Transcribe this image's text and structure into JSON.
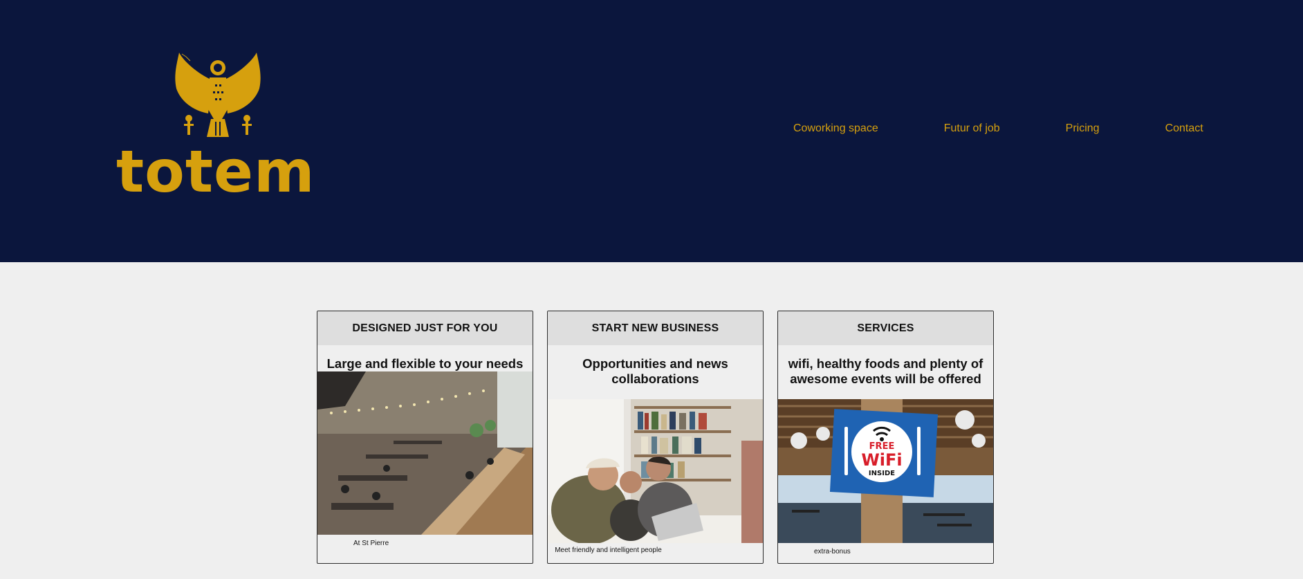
{
  "brand": {
    "name": "totem",
    "color": "#d6a00e",
    "header_bg": "#0b163d"
  },
  "nav": [
    {
      "label": "Coworking space"
    },
    {
      "label": "Futur of job"
    },
    {
      "label": "Pricing"
    },
    {
      "label": "Contact"
    }
  ],
  "cards": [
    {
      "heading": "DESIGNED JUST FOR YOU",
      "subtitle": "Large and flexible to your needs",
      "caption": "At St Pierre",
      "image": "coworking-space-photo"
    },
    {
      "heading": "START NEW BUSINESS",
      "subtitle": "Opportunities and news collaborations",
      "caption": "Meet friendly and intelligent people",
      "image": "people-at-laptop-photo"
    },
    {
      "heading": "SERVICES",
      "subtitle": "wifi, healthy foods and plenty of awesome events will be offered",
      "caption": "extra-bonus",
      "image": "free-wifi-sign-photo",
      "sign": {
        "line1": "FREE",
        "line2": "WiFi",
        "line3": "INSIDE"
      }
    }
  ]
}
